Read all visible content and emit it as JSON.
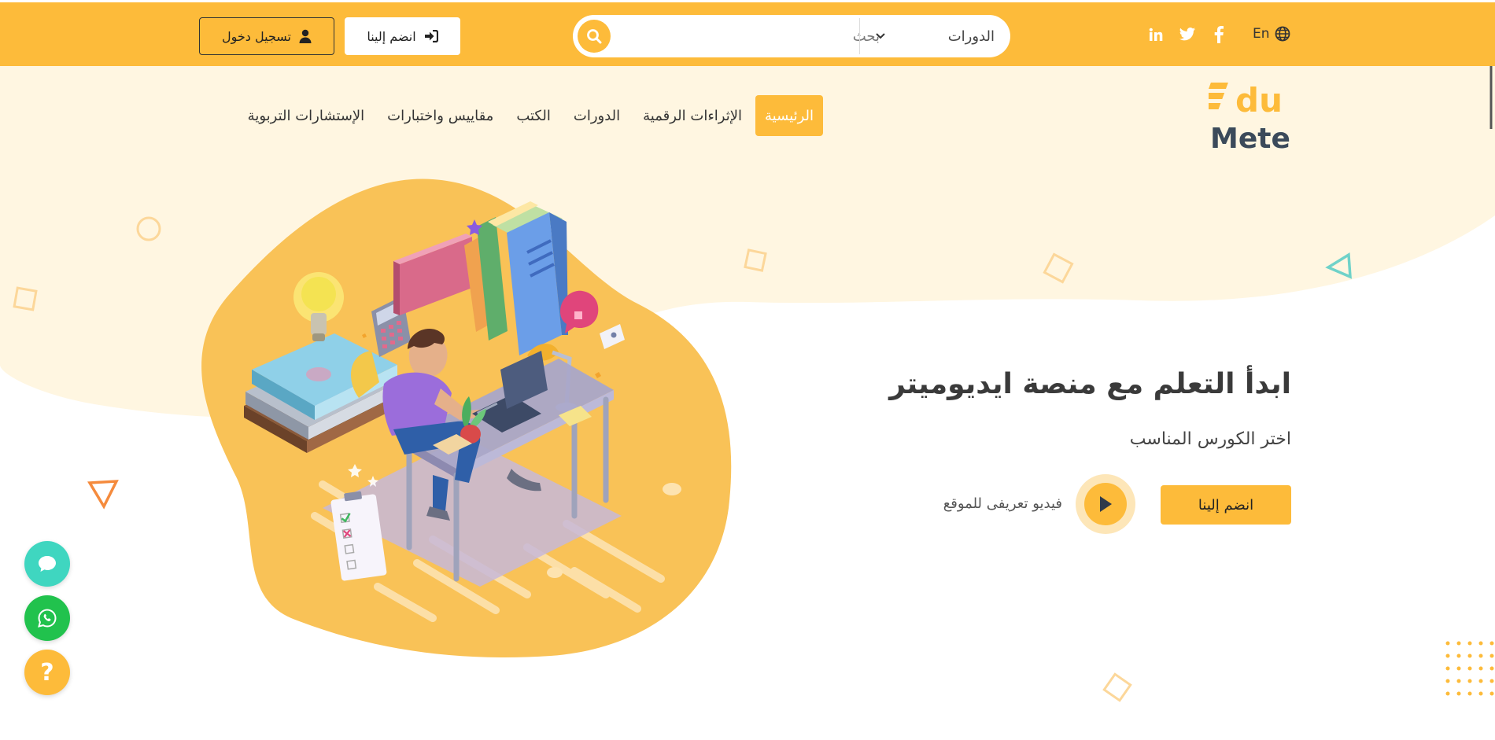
{
  "topbar": {
    "lang_label": "En",
    "social_icons": [
      "linkedin-icon",
      "twitter-icon",
      "facebook-icon"
    ],
    "search": {
      "placeholder": "بحث",
      "category_selected": "الدورات"
    },
    "join_label": "انضم إلينا",
    "login_label": "تسجيل دخول"
  },
  "logo": {
    "line1": "du",
    "line2": "Meter"
  },
  "nav": {
    "items": [
      {
        "label": "الرئيسية",
        "active": true
      },
      {
        "label": "الإثراءات الرقمية",
        "active": false
      },
      {
        "label": "الدورات",
        "active": false
      },
      {
        "label": "الكتب",
        "active": false
      },
      {
        "label": "مقاييس واختبارات",
        "active": false
      },
      {
        "label": "الإستشارات التربوية",
        "active": false
      }
    ]
  },
  "hero": {
    "title": "ابدأ التعلم مع منصة ايديوميتر",
    "subtitle": "اختر الكورس المناسب",
    "join_label": "انضم إلينا",
    "video_label": "فيديو تعريفى للموقع"
  },
  "floating": {
    "icons": [
      "chat-icon",
      "whatsapp-icon",
      "help-icon"
    ],
    "help_glyph": "?"
  },
  "colors": {
    "accent": "#fdbb3a",
    "hero_light": "#fff6e1",
    "chat": "#3fd6c0",
    "whatsapp": "#21c24d",
    "text_dark": "#3a3a3a"
  }
}
